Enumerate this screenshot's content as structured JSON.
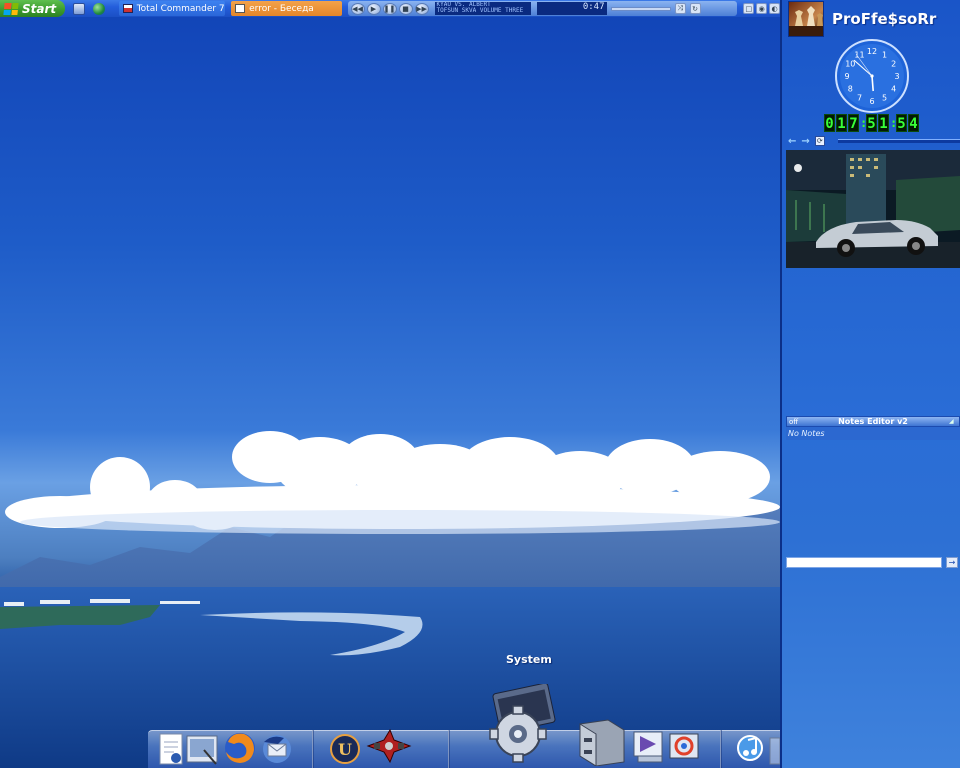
{
  "taskbar": {
    "start_label": "Start",
    "tasks": [
      {
        "label": "Total Commander 7.0...",
        "icon": "floppy-disk-icon"
      },
      {
        "label": "error - Беседа",
        "icon": "chat-window-icon"
      }
    ],
    "quick_launch": [
      "show-desktop-icon",
      "globe-icon"
    ],
    "player": {
      "track_line1": "KYAU VS. ALBERT",
      "track_line2": "TOFSUN SKVA VOLUME THREE",
      "time": "0:47",
      "controls": [
        "previous",
        "play",
        "pause",
        "stop",
        "next"
      ]
    }
  },
  "sidebar": {
    "user_name": "ProFfe$soRr",
    "clock": {
      "time_digits": [
        "0",
        "1",
        "7",
        ":",
        "5",
        "1",
        ":",
        "5",
        "4"
      ],
      "hour": 17,
      "minute": 51,
      "second": 54,
      "dial_numbers": [
        "12",
        "1",
        "2",
        "3",
        "4",
        "5",
        "6",
        "7",
        "8",
        "9",
        "10",
        "11"
      ]
    },
    "nav": {
      "back": "←",
      "forward": "→",
      "refresh": "⟳"
    },
    "notes": {
      "off_label": "off",
      "title": "Notes Editor v2",
      "empty_text": "No Notes",
      "go_label": "→"
    }
  },
  "dock": {
    "active_label": "System",
    "groups": [
      [
        "document-icon",
        "image-viewer-icon",
        "firefox-icon",
        "thunderbird-icon"
      ],
      [
        "unreal-tournament-icon",
        "spaceship-game-icon"
      ],
      [
        "system-gear-icon",
        "file-cabinet-icon",
        "media-player-icon",
        "display-settings-icon"
      ],
      [
        "itunes-icon",
        "recycle-bin-icon"
      ]
    ]
  },
  "colors": {
    "taskbar": "#245edb",
    "start_green": "#3a9a2c",
    "sidebar": "#2364d0",
    "clock_digits": "#38ff38",
    "active_task": "#e4862a"
  }
}
